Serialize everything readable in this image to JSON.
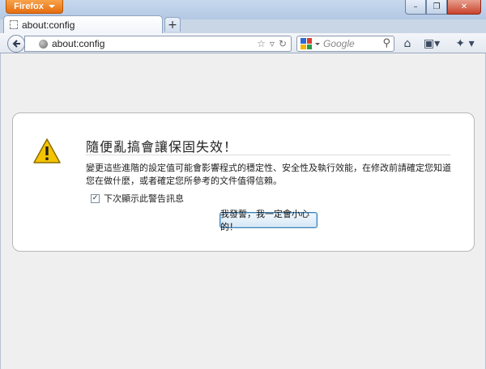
{
  "app": {
    "menu_button_label": "Firefox"
  },
  "window_controls": {
    "minimize": "–",
    "restore": "❐",
    "close": "✕"
  },
  "tabs": [
    {
      "label": "about:config"
    }
  ],
  "new_tab_label": "+",
  "address_bar": {
    "url": "about:config"
  },
  "search_bar": {
    "placeholder": "Google"
  },
  "warning": {
    "title": "隨便亂搞會讓保固失效！",
    "body": "變更這些進階的設定值可能會影響程式的穩定性、安全性及執行效能，在修改前請確定您知道您在做什麼，或者確定您所參考的文件值得信賴。",
    "checkbox_label": "下次顯示此警告訊息",
    "checkbox_checked": true,
    "accept_button_label": "我發誓，我一定會小心的！"
  },
  "colors": {
    "accent": "#e56e10",
    "button_border": "#3c7fb1"
  }
}
